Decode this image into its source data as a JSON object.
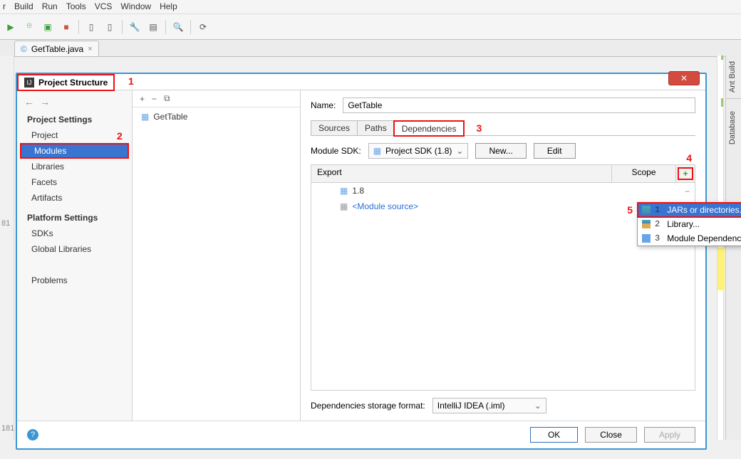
{
  "menu": {
    "items": [
      "Build",
      "Run",
      "Tools",
      "VCS",
      "Window",
      "Help"
    ]
  },
  "editor_tab": {
    "label": "GetTable.java"
  },
  "dialog": {
    "title": "Project Structure",
    "sidebar": {
      "nav_back": "←",
      "nav_fwd": "→",
      "heading1": "Project Settings",
      "items1": [
        "Project",
        "Modules",
        "Libraries",
        "Facets",
        "Artifacts"
      ],
      "heading2": "Platform Settings",
      "items2": [
        "SDKs",
        "Global Libraries"
      ],
      "heading3": "",
      "problems": "Problems"
    },
    "mid": {
      "plus": "+",
      "minus": "−",
      "copy": "⧉",
      "tree_item": "GetTable"
    },
    "right": {
      "name_label": "Name:",
      "name_value": "GetTable",
      "tabs": [
        "Sources",
        "Paths",
        "Dependencies"
      ],
      "sdk_label": "Module SDK:",
      "sdk_value": "Project SDK (1.8)",
      "new_btn": "New...",
      "edit_btn": "Edit",
      "col_export": "Export",
      "col_scope": "Scope",
      "plus": "+",
      "minus": "−",
      "pencil": "✎",
      "row1": "1.8",
      "row2": "<Module source>",
      "storage_label": "Dependencies storage format:",
      "storage_value": "IntelliJ IDEA (.iml)"
    },
    "popup": {
      "r1": "JARs or directories...",
      "r2": "Library...",
      "r3": "Module Dependency...",
      "n1": "1",
      "n2": "2",
      "n3": "3"
    },
    "footer": {
      "ok": "OK",
      "close": "Close",
      "apply": "Apply"
    },
    "ann": {
      "a1": "1",
      "a2": "2",
      "a3": "3",
      "a4": "4",
      "a5": "5"
    }
  },
  "dock": {
    "t1": "Ant Build",
    "t2": "Database"
  },
  "gutter": {
    "l1": "81",
    "l2": "181"
  }
}
